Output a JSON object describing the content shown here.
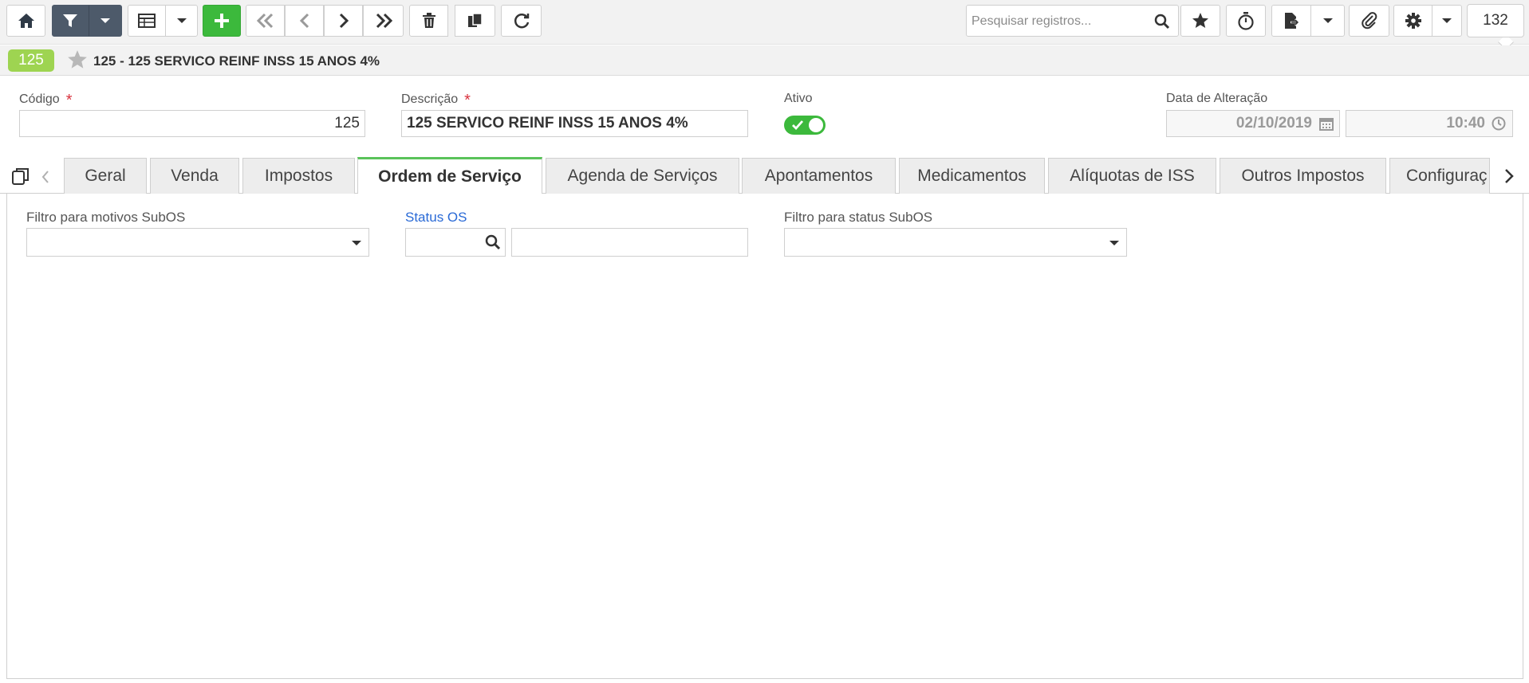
{
  "toolbar": {
    "search_placeholder": "Pesquisar registros...",
    "record_count": "132"
  },
  "record": {
    "badge": "125",
    "title": "125 - 125 SERVICO REINF INSS 15 ANOS 4%"
  },
  "form": {
    "codigo_label": "Código",
    "codigo_value": "125",
    "descricao_label": "Descrição",
    "descricao_value": "125 SERVICO REINF INSS 15 ANOS 4%",
    "ativo_label": "Ativo",
    "ativo_value": true,
    "data_label": "Data de Alteração",
    "data_date": "02/10/2019",
    "data_time": "10:40",
    "required_mark": "*"
  },
  "tabs": [
    {
      "label": "Geral"
    },
    {
      "label": "Venda"
    },
    {
      "label": "Impostos"
    },
    {
      "label": "Ordem de Serviço",
      "active": true
    },
    {
      "label": "Agenda de Serviços"
    },
    {
      "label": "Apontamentos"
    },
    {
      "label": "Medicamentos"
    },
    {
      "label": "Alíquotas de ISS"
    },
    {
      "label": "Outros Impostos"
    },
    {
      "label": "Configuraç"
    }
  ],
  "ordem_servico": {
    "filtro_motivos_label": "Filtro para motivos SubOS",
    "filtro_motivos_value": "",
    "status_os_label": "Status OS",
    "status_os_code": "",
    "status_os_desc": "",
    "filtro_status_label": "Filtro para status SubOS",
    "filtro_status_value": ""
  },
  "colors": {
    "accent_green": "#3cb93c",
    "badge_green": "#9ed451",
    "filter_dark": "#4d5a6a",
    "required_red": "#d9333f",
    "link_blue": "#2a6ad6"
  }
}
